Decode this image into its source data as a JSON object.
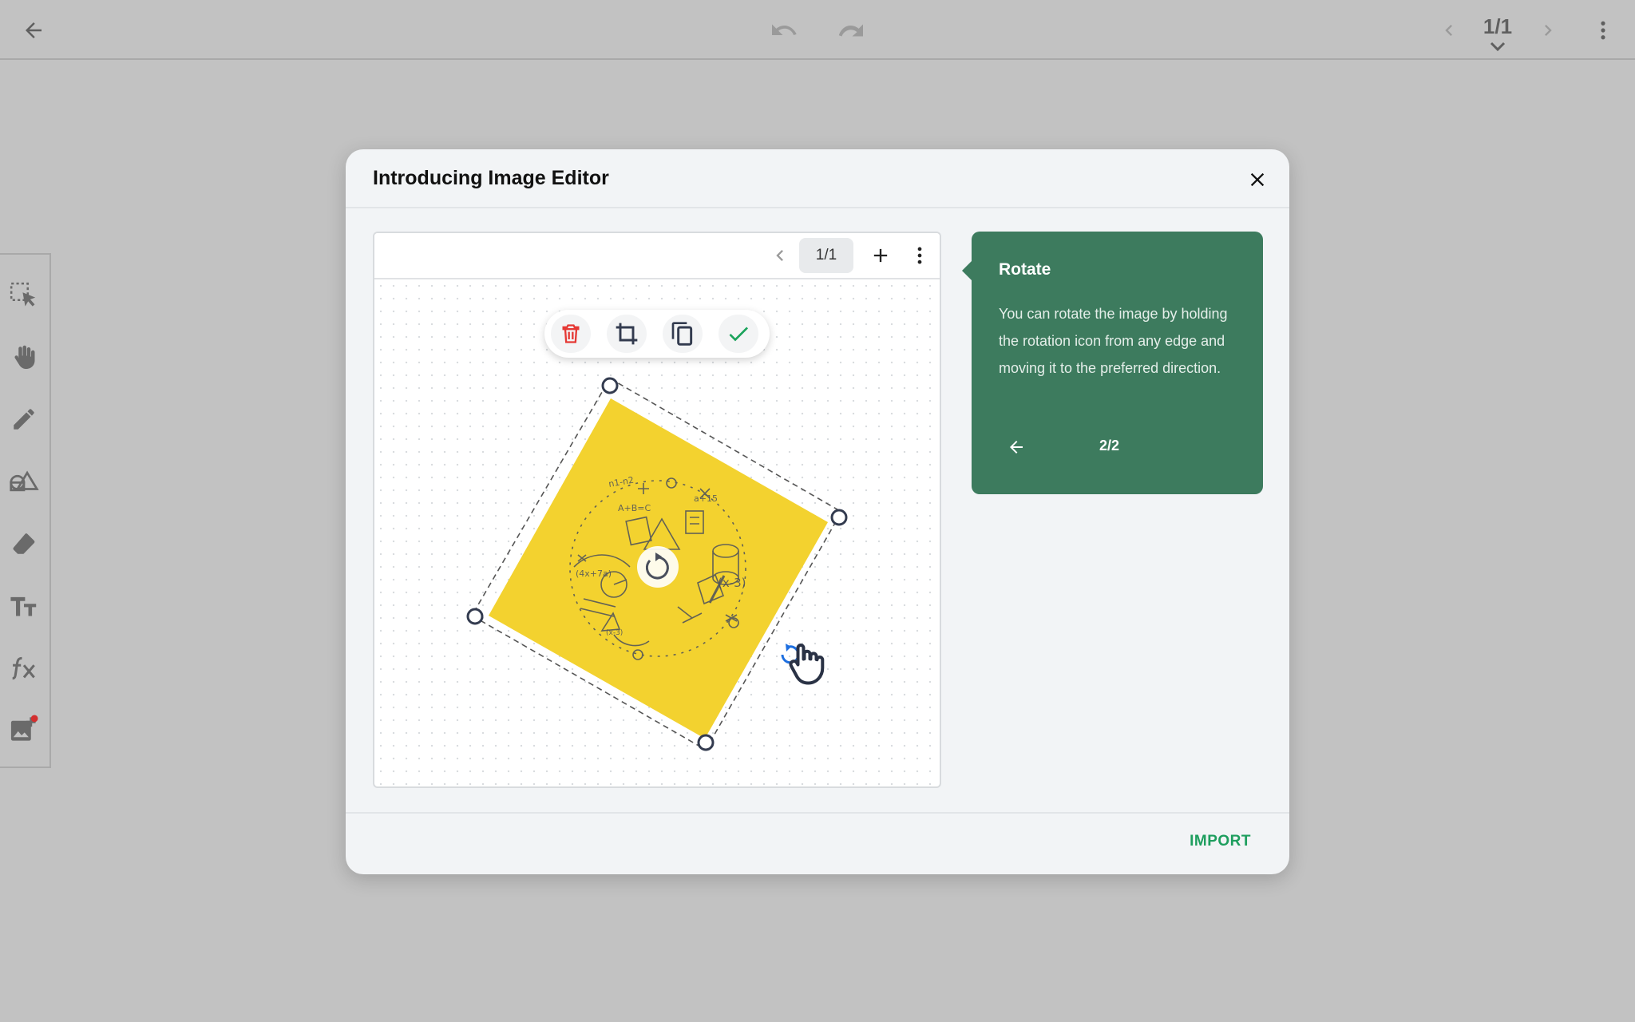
{
  "topbar": {
    "page_indicator": "1/1",
    "icons": [
      "back-arrow-icon",
      "undo-icon",
      "redo-icon",
      "chevron-left-icon",
      "chevron-right-icon",
      "more-vert-icon",
      "chevron-down-icon"
    ]
  },
  "toolrail": {
    "tools": [
      "select-icon",
      "hand-icon",
      "pen-icon",
      "shapes-icon",
      "eraser-icon",
      "text-icon",
      "formula-icon",
      "image-icon"
    ],
    "image_badge_color": "#d32f2f"
  },
  "modal": {
    "title": "Introducing Image Editor",
    "import_label": "IMPORT",
    "accent_color": "#1e9e5e"
  },
  "preview": {
    "page_indicator": "1/1",
    "context_toolbar": [
      "delete-icon",
      "crop-icon",
      "duplicate-icon",
      "confirm-icon"
    ],
    "image_background": "#f3d22f"
  },
  "tip": {
    "title": "Rotate",
    "body": "You can rotate the image by holding the rotation icon from any edge and moving it to the preferred direction.",
    "counter": "2/2",
    "background": "#3d7b5e"
  }
}
